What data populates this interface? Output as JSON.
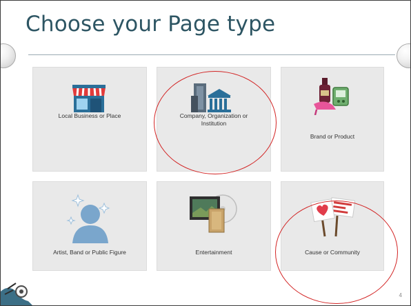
{
  "slide": {
    "title": "Choose your Page type",
    "page_number": "4"
  },
  "tiles": [
    {
      "label": "Local Business or Place",
      "icon": "storefront-icon"
    },
    {
      "label": "Company, Organization or\nInstitution",
      "icon": "building-bank-icon"
    },
    {
      "label": "Brand or Product",
      "icon": "shoe-bottle-product-icon"
    },
    {
      "label": "Artist, Band or Public Figure",
      "icon": "person-sparkles-icon"
    },
    {
      "label": "Entertainment",
      "icon": "tv-film-disc-icon"
    },
    {
      "label": "Cause or Community",
      "icon": "protest-signs-icon"
    }
  ],
  "annotations": {
    "circle_color": "#d22222",
    "circled_tiles": [
      "Company, Organization or\nInstitution",
      "Cause or Community"
    ]
  },
  "colors": {
    "title": "#2d5563",
    "tile_bg": "#e9e9e9",
    "accent_red": "#d22222"
  }
}
